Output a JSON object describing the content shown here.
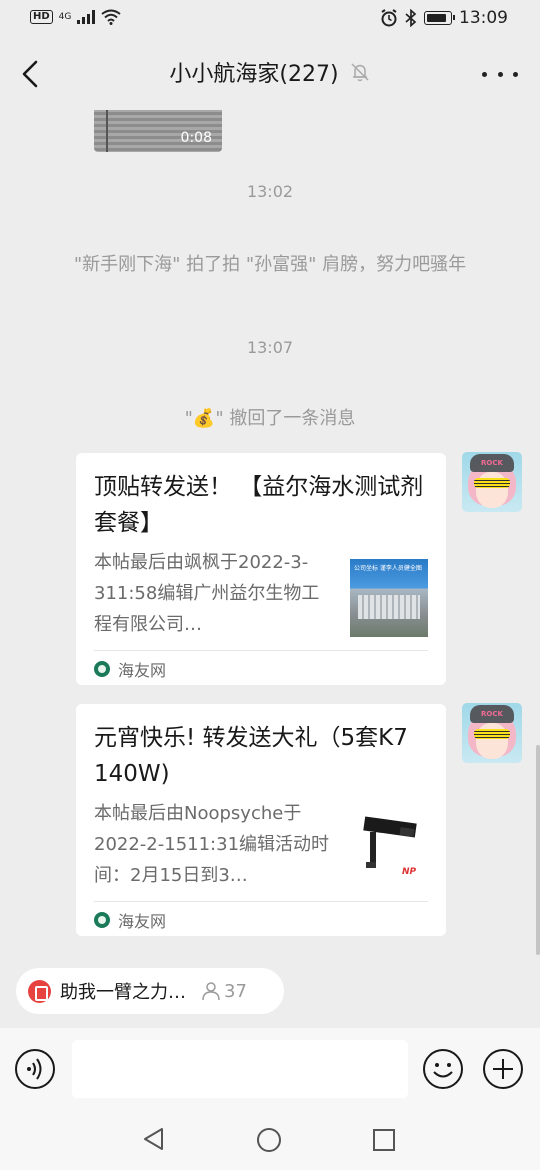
{
  "status_bar": {
    "left_badge": "HD",
    "network": "4G",
    "time": "13:09",
    "battery_level": 0.85
  },
  "header": {
    "title": "小小航海家(227)"
  },
  "chat": {
    "video_duration": "0:08",
    "time_1": "13:02",
    "pat_message": "\"新手刚下海\" 拍了拍 \"孙富强\" 肩膀，努力吧骚年",
    "time_2": "13:07",
    "recall_prefix": "\"",
    "recall_emoji": "💰",
    "recall_suffix": "\" 撤回了一条消息",
    "messages": [
      {
        "title": "顶贴转发送！ 【益尔海水测试剂套餐】",
        "description": "本帖最后由飒枫于2022-3-311:58编辑广州益尔生物工程有限公司…",
        "source": "海友网",
        "thumb_caption": "公司坐标 谨李人员健全图",
        "avatar_text": "ROCK YOUNG"
      },
      {
        "title": "元宵快乐! 转发送大礼（5套K7  140W)",
        "description": "本帖最后由Noopsyche于2022-2-1511:31编辑活动时间：2月15日到3…",
        "source": "海友网",
        "thumb_caption": "NP",
        "avatar_text": "ROCK YOUNG"
      }
    ]
  },
  "pinned": {
    "text": "助我一臂之力…",
    "count": "37"
  },
  "input": {
    "placeholder": ""
  },
  "icons": {
    "back": "back-arrow-icon",
    "mute": "mute-bell-icon",
    "more": "more-dots-icon",
    "voice": "voice-icon",
    "emoji": "emoji-icon",
    "plus": "plus-icon",
    "source": "haiyou-logo-icon",
    "people": "person-icon"
  },
  "colors": {
    "background": "#ededed",
    "bubble": "#ffffff",
    "muted_text": "#9a9a9a",
    "chip_icon": "#e64340"
  }
}
